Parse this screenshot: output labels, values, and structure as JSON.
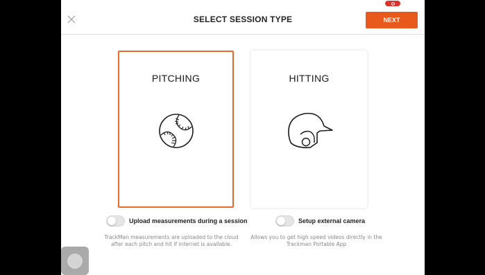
{
  "header": {
    "title": "SELECT SESSION TYPE",
    "next_label": "NEXT",
    "accent_color": "#e85a1c"
  },
  "cards": [
    {
      "label": "PITCHING",
      "icon": "baseball-icon",
      "selected": true
    },
    {
      "label": "HITTING",
      "icon": "batting-helmet-icon",
      "selected": false
    }
  ],
  "toggles": {
    "upload": {
      "label": "Upload measurements during a session",
      "on": false,
      "description_line1": "TrackMan measurements are uploaded to the cloud",
      "description_line2": "after each pitch and hit if internet is available."
    },
    "camera": {
      "label": "Setup external camera",
      "on": false,
      "description_line1": "Allows you to get high speed videos directly in the",
      "description_line2": "Trackman Portable App"
    }
  }
}
